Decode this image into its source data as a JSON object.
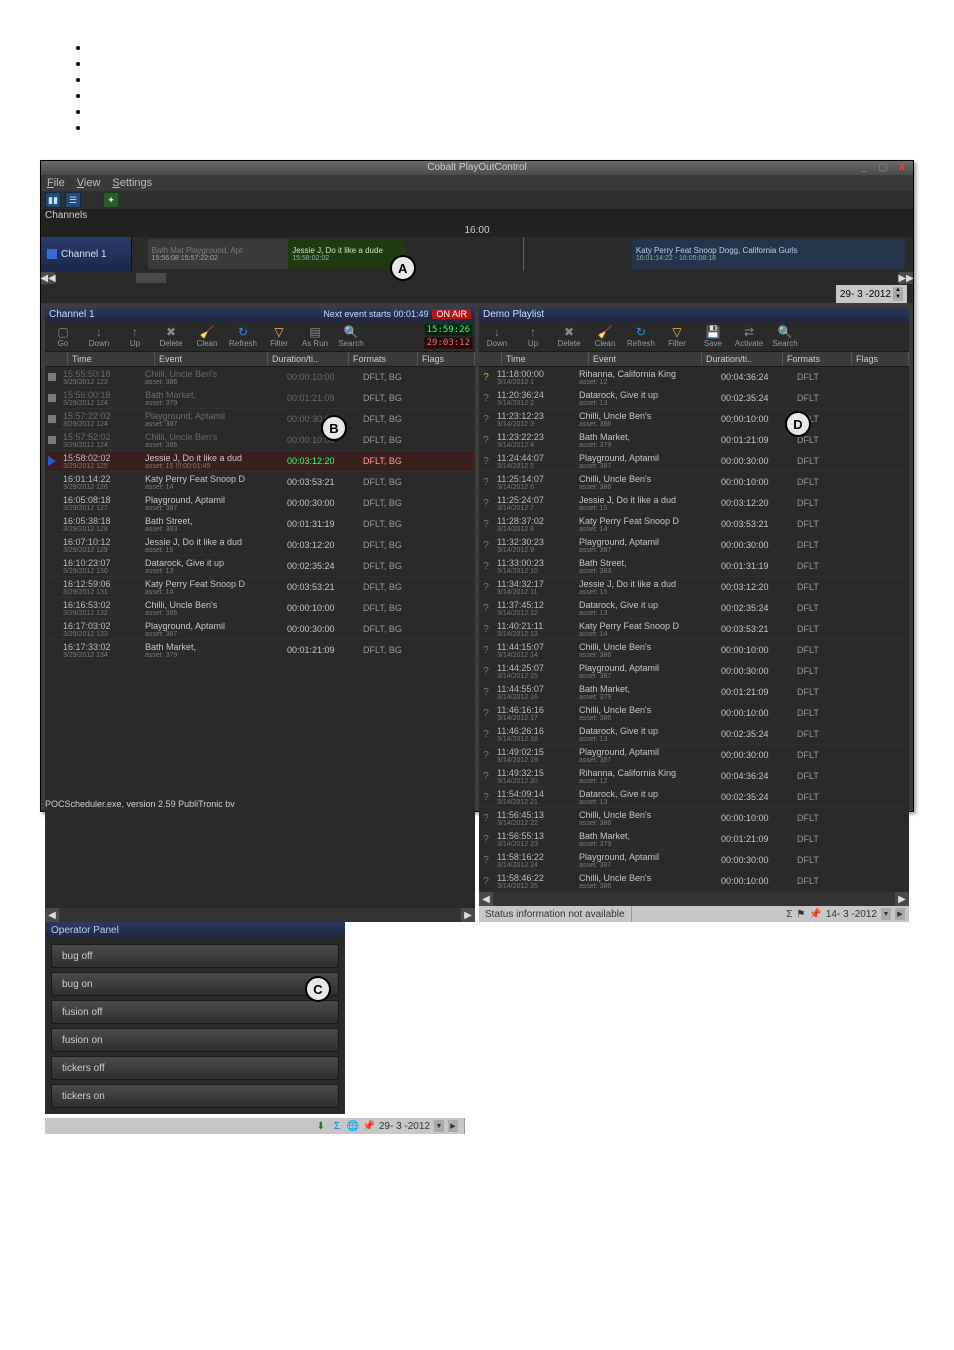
{
  "window": {
    "title": "Cobalt PlayOutControl",
    "menus": [
      "File",
      "View",
      "Settings"
    ],
    "date_right": "29- 3 -2012"
  },
  "channels_header": "Channels",
  "channel1": {
    "name": "Channel 1",
    "ruler_time": "16:00",
    "clips": {
      "dim_label_1": "Bath Mat Playground, Apt",
      "dim_label_1_sub": "15:56:08 15:57:22:02",
      "green_label": "Jessie J, Do it like a dude",
      "green_time": "15:58:02:02",
      "blue_label": "Katy Perry Feat Snoop Dogg, California Gurls",
      "blue_time": "16:01:14:22 - 16:05:08:18"
    }
  },
  "panel_left": {
    "title": "Channel 1",
    "next_event": "Next event starts 00:01:49",
    "onair": "ON AIR",
    "clock_green": "15:59:26",
    "clock_red": "29:03:12",
    "tools": [
      "Go",
      "Down",
      "Up",
      "Delete",
      "Clean",
      "Refresh",
      "Filter",
      "As Run",
      "Search"
    ],
    "cols": [
      "Time",
      "Event",
      "Duration/ti..",
      "Formats",
      "Flags"
    ],
    "rows": [
      {
        "icon": "stop",
        "dim": true,
        "time": "15:55:50:18",
        "date": "3/29/2012  123",
        "event": "Chilli, Uncle Ben's",
        "asset": "asset: 386",
        "dur": "00:00:10:00",
        "fmt": "DFLT, BG"
      },
      {
        "icon": "stop",
        "dim": true,
        "time": "15:56:00:18",
        "date": "3/29/2012  124",
        "event": "Bath Market,",
        "asset": "asset: 379",
        "dur": "00:01:21:09",
        "fmt": "DFLT, BG"
      },
      {
        "icon": "stop",
        "dim": true,
        "time": "15:57:22:02",
        "date": "3/29/2012  124",
        "event": "Playground, Aptamil",
        "asset": "asset: 387",
        "dur": "00:00:30:00",
        "fmt": "DFLT, BG"
      },
      {
        "icon": "stop",
        "dim": true,
        "time": "15:57:52:02",
        "date": "3/29/2012  124",
        "event": "Chilli, Uncle Ben's",
        "asset": "asset: 386",
        "dur": "00:00:10:00",
        "fmt": "DFLT, BG"
      },
      {
        "icon": "play",
        "sel": true,
        "time": "15:58:02:02",
        "date": "3/29/2012  125",
        "event": "Jessie J, Do it like a dud",
        "asset": "asset: 15   !!!:00:01:49",
        "dur": "00:03:12:20",
        "fmt": "DFLT, BG"
      },
      {
        "icon": "",
        "time": "16:01:14:22",
        "date": "3/29/2012  126",
        "event": "Katy Perry Feat Snoop D",
        "asset": "asset: 14",
        "dur": "00:03:53:21",
        "fmt": "DFLT, BG"
      },
      {
        "icon": "",
        "time": "16:05:08:18",
        "date": "3/29/2012  127",
        "event": "Playground, Aptamil",
        "asset": "asset: 387",
        "dur": "00:00:30:00",
        "fmt": "DFLT, BG"
      },
      {
        "icon": "",
        "time": "16:05:38:18",
        "date": "3/29/2012  128",
        "event": "Bath Street,",
        "asset": "asset: 383",
        "dur": "00:01:31:19",
        "fmt": "DFLT, BG"
      },
      {
        "icon": "",
        "time": "16:07:10:12",
        "date": "3/29/2012  129",
        "event": "Jessie J, Do it like a dud",
        "asset": "asset: 15",
        "dur": "00:03:12:20",
        "fmt": "DFLT, BG"
      },
      {
        "icon": "",
        "time": "16:10:23:07",
        "date": "3/29/2012  130",
        "event": "Datarock, Give it up",
        "asset": "asset: 13",
        "dur": "00:02:35:24",
        "fmt": "DFLT, BG"
      },
      {
        "icon": "",
        "time": "16:12:59:06",
        "date": "3/29/2012  131",
        "event": "Katy Perry Feat Snoop D",
        "asset": "asset: 14",
        "dur": "00:03:53:21",
        "fmt": "DFLT, BG"
      },
      {
        "icon": "",
        "time": "16:16:53:02",
        "date": "3/29/2012  132",
        "event": "Chilli, Uncle Ben's",
        "asset": "asset: 386",
        "dur": "00:00:10:00",
        "fmt": "DFLT, BG"
      },
      {
        "icon": "",
        "time": "16:17:03:02",
        "date": "3/29/2012  133",
        "event": "Playground, Aptamil",
        "asset": "asset: 387",
        "dur": "00:00:30:00",
        "fmt": "DFLT, BG"
      },
      {
        "icon": "",
        "time": "16:17:33:02",
        "date": "3/29/2012  134",
        "event": "Bath Market,",
        "asset": "asset: 379",
        "dur": "00:01:21:09",
        "fmt": "DFLT, BG"
      }
    ],
    "status_date": "29- 3 -2012"
  },
  "panel_right": {
    "title": "Demo Playlist",
    "tools": [
      "Down",
      "Up",
      "Delete",
      "Clean",
      "Refresh",
      "Filter",
      "Save",
      "Activate",
      "Search"
    ],
    "cols": [
      "Time",
      "Event",
      "Duration/ti..",
      "Formats",
      "Flags"
    ],
    "rows": [
      {
        "icon": "qy",
        "time": "11:18:00:00",
        "date": "3/14/2012  1",
        "event": "Rihanna, California King",
        "asset": "asset: 12",
        "dur": "00:04:36:24",
        "fmt": "DFLT"
      },
      {
        "icon": "q",
        "time": "11:20:36:24",
        "date": "3/14/2012  2",
        "event": "Datarock, Give it up",
        "asset": "asset: 13",
        "dur": "00:02:35:24",
        "fmt": "DFLT"
      },
      {
        "icon": "q",
        "time": "11:23:12:23",
        "date": "3/14/2012  3",
        "event": "Chilli, Uncle Ben's",
        "asset": "asset: 386",
        "dur": "00:00:10:00",
        "fmt": "DFLT"
      },
      {
        "icon": "q",
        "time": "11:23:22:23",
        "date": "3/14/2012  4",
        "event": "Bath Market,",
        "asset": "asset: 379",
        "dur": "00:01:21:09",
        "fmt": "DFLT"
      },
      {
        "icon": "q",
        "time": "11:24:44:07",
        "date": "3/14/2012  5",
        "event": "Playground, Aptamil",
        "asset": "asset: 387",
        "dur": "00:00:30:00",
        "fmt": "DFLT"
      },
      {
        "icon": "q",
        "time": "11:25:14:07",
        "date": "3/14/2012  6",
        "event": "Chilli, Uncle Ben's",
        "asset": "asset: 386",
        "dur": "00:00:10:00",
        "fmt": "DFLT"
      },
      {
        "icon": "q",
        "time": "11:25:24:07",
        "date": "3/14/2012  7",
        "event": "Jessie J, Do it like a dud",
        "asset": "asset: 15",
        "dur": "00:03:12:20",
        "fmt": "DFLT"
      },
      {
        "icon": "q",
        "time": "11:28:37:02",
        "date": "3/14/2012  8",
        "event": "Katy Perry Feat Snoop D",
        "asset": "asset: 14",
        "dur": "00:03:53:21",
        "fmt": "DFLT"
      },
      {
        "icon": "q",
        "time": "11:32:30:23",
        "date": "3/14/2012  9",
        "event": "Playground, Aptamil",
        "asset": "asset: 387",
        "dur": "00:00:30:00",
        "fmt": "DFLT"
      },
      {
        "icon": "q",
        "time": "11:33:00:23",
        "date": "3/14/2012  10",
        "event": "Bath Street,",
        "asset": "asset: 383",
        "dur": "00:01:31:19",
        "fmt": "DFLT"
      },
      {
        "icon": "q",
        "time": "11:34:32:17",
        "date": "3/14/2012  11",
        "event": "Jessie J, Do it like a dud",
        "asset": "asset: 15",
        "dur": "00:03:12:20",
        "fmt": "DFLT"
      },
      {
        "icon": "q",
        "time": "11:37:45:12",
        "date": "3/14/2012  12",
        "event": "Datarock, Give it up",
        "asset": "asset: 13",
        "dur": "00:02:35:24",
        "fmt": "DFLT"
      },
      {
        "icon": "q",
        "time": "11:40:21:11",
        "date": "3/14/2012  13",
        "event": "Katy Perry Feat Snoop D",
        "asset": "asset: 14",
        "dur": "00:03:53:21",
        "fmt": "DFLT"
      },
      {
        "icon": "q",
        "time": "11:44:15:07",
        "date": "3/14/2012  14",
        "event": "Chilli, Uncle Ben's",
        "asset": "asset: 386",
        "dur": "00:00:10:00",
        "fmt": "DFLT"
      },
      {
        "icon": "q",
        "time": "11:44:25:07",
        "date": "3/14/2012  15",
        "event": "Playground, Aptamil",
        "asset": "asset: 387",
        "dur": "00:00:30:00",
        "fmt": "DFLT"
      },
      {
        "icon": "q",
        "time": "11:44:55:07",
        "date": "3/14/2012  16",
        "event": "Bath Market,",
        "asset": "asset: 379",
        "dur": "00:01:21:09",
        "fmt": "DFLT"
      },
      {
        "icon": "q",
        "time": "11:46:16:16",
        "date": "3/14/2012  17",
        "event": "Chilli, Uncle Ben's",
        "asset": "asset: 386",
        "dur": "00:00:10:00",
        "fmt": "DFLT"
      },
      {
        "icon": "q",
        "time": "11:46:26:16",
        "date": "3/14/2012  18",
        "event": "Datarock, Give it up",
        "asset": "asset: 13",
        "dur": "00:02:35:24",
        "fmt": "DFLT"
      },
      {
        "icon": "q",
        "time": "11:49:02:15",
        "date": "3/14/2012  19",
        "event": "Playground, Aptamil",
        "asset": "asset: 387",
        "dur": "00:00:30:00",
        "fmt": "DFLT"
      },
      {
        "icon": "q",
        "time": "11:49:32:15",
        "date": "3/14/2012  20",
        "event": "Rihanna, California King",
        "asset": "asset: 12",
        "dur": "00:04:36:24",
        "fmt": "DFLT"
      },
      {
        "icon": "q",
        "time": "11:54:09:14",
        "date": "3/14/2012  21",
        "event": "Datarock, Give it up",
        "asset": "asset: 13",
        "dur": "00:02:35:24",
        "fmt": "DFLT"
      },
      {
        "icon": "q",
        "time": "11:56:45:13",
        "date": "3/14/2012  22",
        "event": "Chilli, Uncle Ben's",
        "asset": "asset: 386",
        "dur": "00:00:10:00",
        "fmt": "DFLT"
      },
      {
        "icon": "q",
        "time": "11:56:55:13",
        "date": "3/14/2012  23",
        "event": "Bath Market,",
        "asset": "asset: 379",
        "dur": "00:01:21:09",
        "fmt": "DFLT"
      },
      {
        "icon": "q",
        "time": "11:58:16:22",
        "date": "3/14/2012  24",
        "event": "Playground, Aptamil",
        "asset": "asset: 387",
        "dur": "00:00:30:00",
        "fmt": "DFLT"
      },
      {
        "icon": "q",
        "time": "11:58:46:22",
        "date": "3/14/2012  25",
        "event": "Chilli, Uncle Ben's",
        "asset": "asset: 386",
        "dur": "00:00:10:00",
        "fmt": "DFLT"
      }
    ],
    "status_text": "Status information not available",
    "status_date": "14- 3 -2012"
  },
  "operator_panel": {
    "title": "Operator Panel",
    "buttons": [
      "bug off",
      "bug on",
      "fusion off",
      "fusion on",
      "tickers off",
      "tickers on"
    ]
  },
  "markers": {
    "A": "A",
    "B": "B",
    "C": "C",
    "D": "D"
  },
  "footer": "POCScheduler.exe, version 2.59 PubliTronic bv"
}
